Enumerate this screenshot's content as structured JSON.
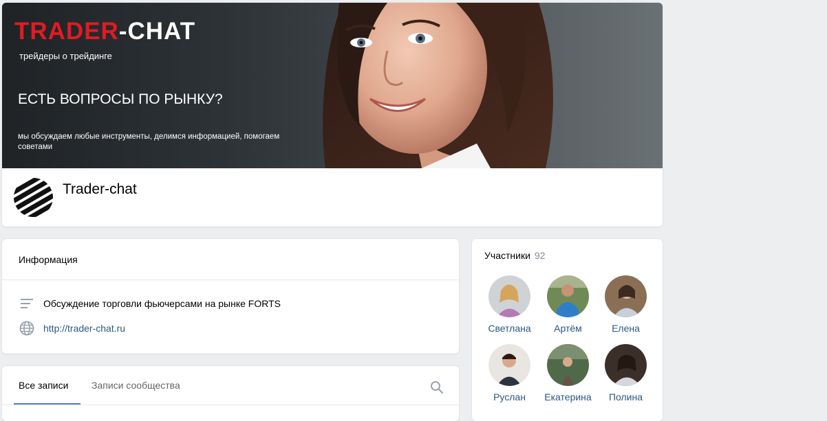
{
  "cover": {
    "brand_red": "TRADER",
    "brand_white": "-CHAT",
    "tagline": "трейдеры о трейдинге",
    "question": "ЕСТЬ ВОПРОСЫ ПО РЫНКУ?",
    "subtext": "мы обсуждаем любые инструменты, делимся информацией, помогаем советами"
  },
  "group": {
    "title": "Trader-chat"
  },
  "info": {
    "heading": "Информация",
    "description": "Обсуждение торговли фьючерсами на рынке FORTS",
    "website": "http://trader-chat.ru"
  },
  "posts": {
    "tab_all": "Все записи",
    "tab_community": "Записи сообщества"
  },
  "members": {
    "label": "Участники",
    "count": "92",
    "list": [
      {
        "name": "Светлана"
      },
      {
        "name": "Артём"
      },
      {
        "name": "Елена"
      },
      {
        "name": "Руслан"
      },
      {
        "name": "Екатерина"
      },
      {
        "name": "Полина"
      }
    ]
  },
  "colors": {
    "background": "#edeef0",
    "brand_red": "#e11b22",
    "link": "#2a5885",
    "accent": "#5181b8",
    "muted": "#818c99"
  }
}
